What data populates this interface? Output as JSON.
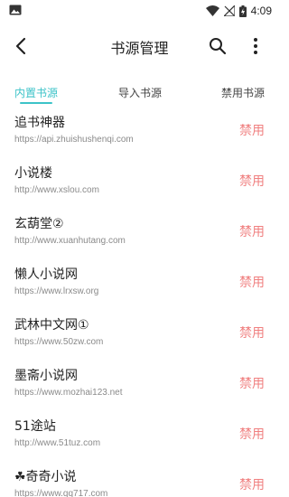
{
  "status_bar": {
    "time": "4:09",
    "icons": [
      "image-icon",
      "wifi-icon",
      "no-signal-icon",
      "battery-charging-icon"
    ]
  },
  "toolbar": {
    "title": "书源管理",
    "back_icon": "back-arrow-icon",
    "search_icon": "search-icon",
    "more_icon": "more-vertical-icon"
  },
  "tabs": [
    {
      "label": "内置书源",
      "active": true
    },
    {
      "label": "导入书源",
      "active": false
    },
    {
      "label": "禁用书源",
      "active": false
    }
  ],
  "accent_color": "#3cc3c8",
  "disable_color": "#f08080",
  "sources": [
    {
      "name": "追书神器",
      "url": "https://api.zhuishushenqi.com",
      "action": "禁用"
    },
    {
      "name": "小说楼",
      "url": "http://www.xslou.com",
      "action": "禁用"
    },
    {
      "name": "玄葫堂②",
      "url": "http://www.xuanhutang.com",
      "action": "禁用"
    },
    {
      "name": "懒人小说网",
      "url": "https://www.lrxsw.org",
      "action": "禁用"
    },
    {
      "name": "武林中文网①",
      "url": "https://www.50zw.com",
      "action": "禁用"
    },
    {
      "name": "墨斋小说网",
      "url": "https://www.mozhai123.net",
      "action": "禁用"
    },
    {
      "name": "51途站",
      "url": "http://www.51tuz.com",
      "action": "禁用"
    },
    {
      "name": "☘奇奇小说",
      "url": "https://www.qq717.com",
      "action": "禁用"
    }
  ]
}
